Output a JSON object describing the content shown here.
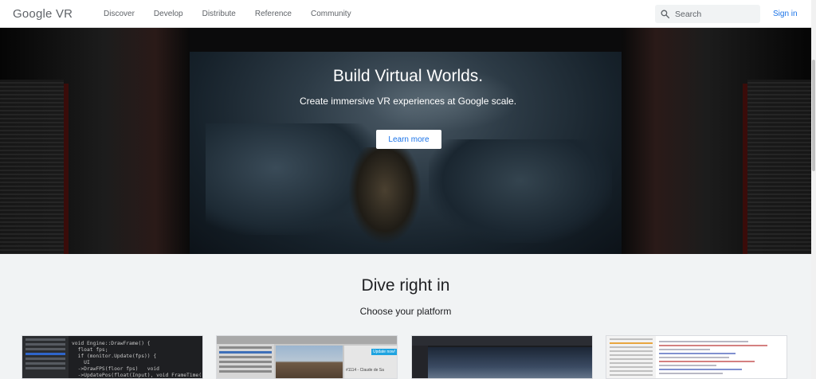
{
  "header": {
    "logo_google": "Google",
    "logo_vr": "VR",
    "nav": [
      "Discover",
      "Develop",
      "Distribute",
      "Reference",
      "Community"
    ],
    "search_placeholder": "Search",
    "sign_in": "Sign in"
  },
  "hero": {
    "title": "Build Virtual Worlds.",
    "subtitle": "Create immersive VR experiences at Google scale.",
    "button": "Learn more"
  },
  "section": {
    "title": "Dive right in",
    "subtitle": "Choose your platform"
  },
  "cards": {
    "code_lines": [
      "void Engine::DrawFrame() {",
      "  float fps;",
      "  if (monitor.Update(fps)) {",
      "    UI",
      "  ->DrawFPS(floor fps)   void",
      "  ->UpdatePos(float(Input), void FrameTime("
    ],
    "unity_badge": "Update now!",
    "unity_text": "#1114 - Claude de Sa"
  },
  "colors": {
    "link_blue": "#1a73e8",
    "section_bg": "#f1f3f4"
  }
}
